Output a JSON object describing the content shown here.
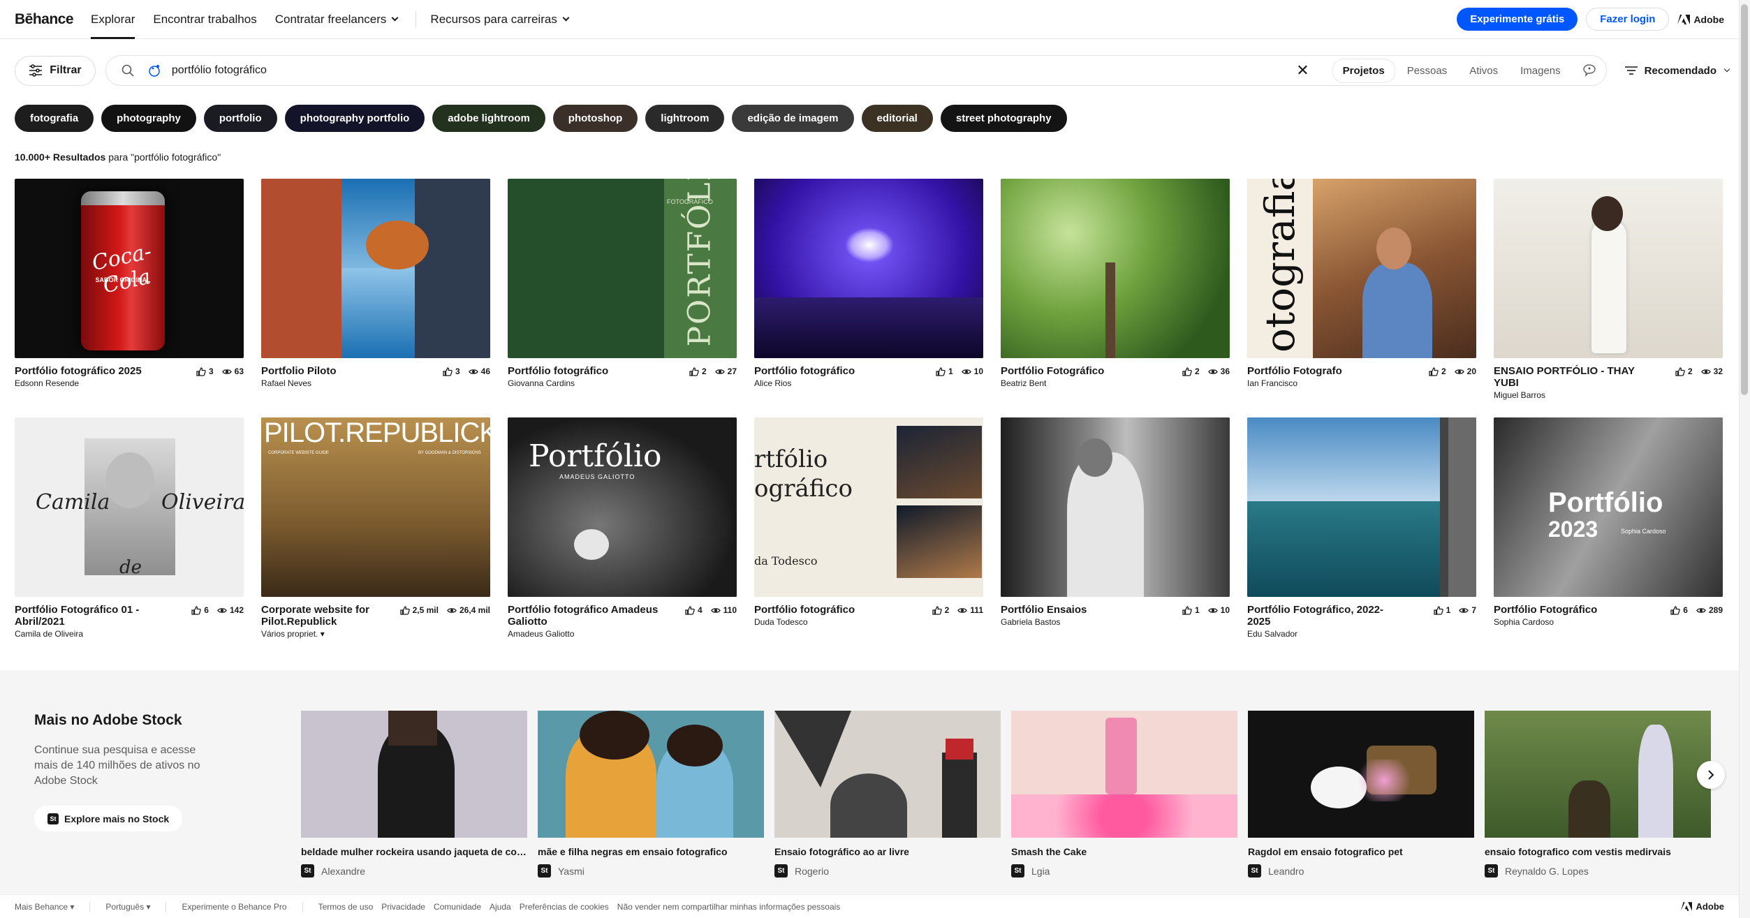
{
  "nav": {
    "logo": "Bēhance",
    "links": [
      "Explorar",
      "Encontrar trabalhos",
      "Contratar freelancers",
      "Recursos para carreiras"
    ],
    "cta_primary": "Experimente grátis",
    "cta_login": "Fazer login",
    "adobe": "Adobe"
  },
  "search": {
    "filter_label": "Filtrar",
    "query": "portfólio fotográfico",
    "tabs": [
      "Projetos",
      "Pessoas",
      "Ativos",
      "Imagens"
    ],
    "selected_tab": "Projetos",
    "sort_label": "Recomendado"
  },
  "tags": [
    {
      "label": "fotografia",
      "color": "#1d1d1d"
    },
    {
      "label": "photography",
      "color": "#121212"
    },
    {
      "label": "portfolio",
      "color": "#1b1b24"
    },
    {
      "label": "photography portfolio",
      "color": "#13132a"
    },
    {
      "label": "adobe lightroom",
      "color": "#23311f"
    },
    {
      "label": "photoshop",
      "color": "#3a2f29"
    },
    {
      "label": "lightroom",
      "color": "#2a2a2a"
    },
    {
      "label": "edição de imagem",
      "color": "#3a3a3a"
    },
    {
      "label": "editorial",
      "color": "#3c3224"
    },
    {
      "label": "street photography",
      "color": "#141414"
    }
  ],
  "results": {
    "count": "10.000+ Resultados",
    "suffix": " para \"portfólio fotográfico\""
  },
  "projects": [
    {
      "title": "Portfólio fotográfico 2025",
      "author": "Edsonn Resende",
      "likes": "3",
      "views": "63",
      "bg": "#0d0d0d"
    },
    {
      "title": "Portfolio Piloto",
      "author": "Rafael Neves",
      "likes": "3",
      "views": "46",
      "bg": "#3b7fb8"
    },
    {
      "title": "Portfólio fotográfico",
      "author": "Giovanna Cardins",
      "likes": "2",
      "views": "27",
      "bg": "#254f2a"
    },
    {
      "title": "Portfólio fotográfico",
      "author": "Alice Rios",
      "likes": "1",
      "views": "10",
      "bg": "#2a1c7a"
    },
    {
      "title": "Portfólio Fotográfico",
      "author": "Beatriz Bent",
      "likes": "2",
      "views": "36",
      "bg": "#5f8d3a"
    },
    {
      "title": "Portfólio Fotografo",
      "author": "Ian Francisco",
      "likes": "2",
      "views": "20",
      "bg": "#7b5637"
    },
    {
      "title": "ENSAIO PORTFÓLIO - THAY YUBI",
      "author": "Miguel Barros",
      "likes": "2",
      "views": "32",
      "bg": "#e9e6df"
    },
    {
      "title": "Portfólio Fotográfico 01 - Abril/2021",
      "author": "Camila de Oliveira",
      "likes": "6",
      "views": "142",
      "bg": "#efefef"
    },
    {
      "title": "Corporate website for Pilot.Republick",
      "author": "Vários propriet.",
      "likes": "2,5 mil",
      "views": "26,4 mil",
      "bg": "#8c6a3d"
    },
    {
      "title": "Portfólio fotográfico Amadeus Galiotto",
      "author": "Amadeus Galiotto",
      "likes": "4",
      "views": "110",
      "bg": "#2c2c2c"
    },
    {
      "title": "Portfólio fotográfico",
      "author": "Duda Todesco",
      "likes": "2",
      "views": "111",
      "bg": "#f0ece1"
    },
    {
      "title": "Portfólio Ensaios",
      "author": "Gabriela Bastos",
      "likes": "1",
      "views": "10",
      "bg": "#5c5c5c"
    },
    {
      "title": "Portfólio Fotográfico, 2022-2025",
      "author": "Edu Salvador",
      "likes": "1",
      "views": "7",
      "bg": "#4b86b5"
    },
    {
      "title": "Portfólio Fotográfico",
      "author": "Sophia Cardoso",
      "likes": "6",
      "views": "289",
      "bg": "#3a3a3a"
    }
  ],
  "thumb_text": {
    "coca": "Coca-Cola",
    "coca_sub": "SABOR ORIGINAL",
    "portfolio_vertical": "PORTFÓLIO",
    "portfolio_small": "FOTOGRÁFICO",
    "fotografia_vertical": "otografia",
    "camila_left": "Camila",
    "camila_right": "Oliveira",
    "camila_de": "de",
    "pilot": "PILOT.REPUBLICK",
    "pilot_sub1": "CORPORATE WEBSITE GUIDE",
    "pilot_sub2": "BY GOODMAN & DISTORSIONS",
    "amadeus_title": "Portfólio",
    "amadeus_sub": "AMADEUS GALIOTTO",
    "duda_line1": "rtfólio",
    "duda_line2": "ográfico",
    "duda_name": "da Todesco",
    "sophia_title": "Portfólio",
    "sophia_year": "2023",
    "sophia_name": "Sophia Cardoso"
  },
  "stock": {
    "title": "Mais no Adobe Stock",
    "description": "Continue sua pesquisa e acesse mais de 140 milhões de ativos no Adobe Stock",
    "button": "Explore mais no Stock",
    "badge": "St",
    "items": [
      {
        "title": "beldade mulher rockeira usando jaqueta de couro,...",
        "author": "Alexandre",
        "bg": "#c9c3cf"
      },
      {
        "title": "mãe e filha negras em ensaio fotografico",
        "author": "Yasmi",
        "bg": "#5a9aa8"
      },
      {
        "title": "Ensaio fotográfico ao ar livre",
        "author": "Rogerio",
        "bg": "#d8d2cd"
      },
      {
        "title": "Smash the Cake",
        "author": "Lgia",
        "bg": "#f4d8d3"
      },
      {
        "title": "Ragdol em ensaio fotografico pet",
        "author": "Leandro",
        "bg": "#121212"
      },
      {
        "title": "ensaio fotografico com vestis medirvais",
        "author": "Reynaldo G. Lopes",
        "bg": "#6b7a3f"
      }
    ]
  },
  "footer": {
    "links_left": [
      "Mais Behance",
      "Português"
    ],
    "pro": "Experimente o Behance Pro",
    "links": [
      "Termos de uso",
      "Privacidade",
      "Comunidade",
      "Ajuda",
      "Preferências de cookies",
      "Não vender nem compartilhar minhas informações pessoais"
    ],
    "adobe": "Adobe"
  }
}
